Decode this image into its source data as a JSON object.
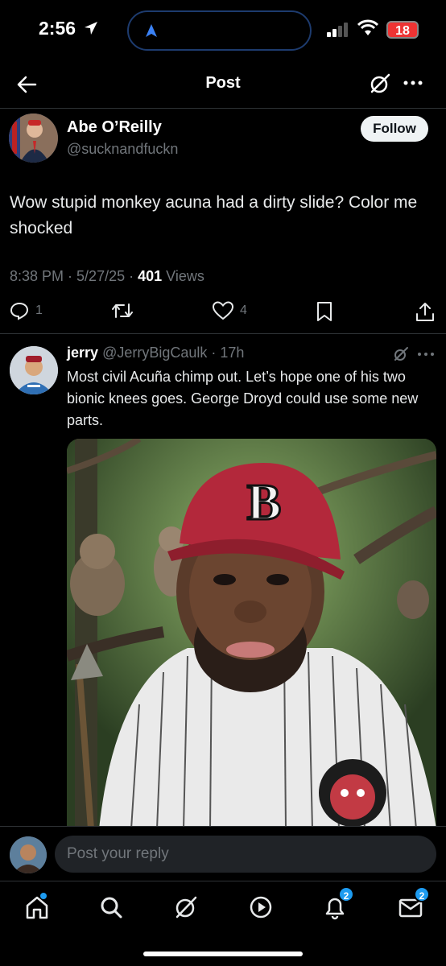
{
  "status_bar": {
    "time": "2:56",
    "battery": "18"
  },
  "header": {
    "title": "Post"
  },
  "post": {
    "author_name": "Abe O’Reilly",
    "author_handle": "@sucknandfuckn",
    "follow_label": "Follow",
    "text": "Wow stupid monkey acuna had a dirty slide? Color me shocked",
    "time": "8:38 PM",
    "date": "5/27/25",
    "views_count": "401",
    "views_label": "Views",
    "replies": "1",
    "likes": "4"
  },
  "reply": {
    "name": "jerry",
    "handle": "@JerryBigCaulk",
    "age": "17h",
    "text": "Most civil Acuña chimp out. Let’s hope one of his two bionic knees goes. George Droyd could use some new parts."
  },
  "composer": {
    "placeholder": "Post your reply"
  },
  "nav": {
    "notifications_badge": "2",
    "messages_badge": "2"
  },
  "icons": [
    "location-arrow-icon",
    "signal-icon",
    "wifi-icon",
    "back-arrow-icon",
    "grok-icon",
    "more-icon",
    "reply-icon",
    "repost-icon",
    "like-icon",
    "bookmark-icon",
    "share-icon",
    "home-icon",
    "search-icon",
    "play-icon",
    "bell-icon",
    "mail-icon"
  ],
  "colors": {
    "accent": "#1d9bf0",
    "follow_bg": "#eff3f4",
    "muted": "#71767b",
    "battery": "#e33"
  }
}
